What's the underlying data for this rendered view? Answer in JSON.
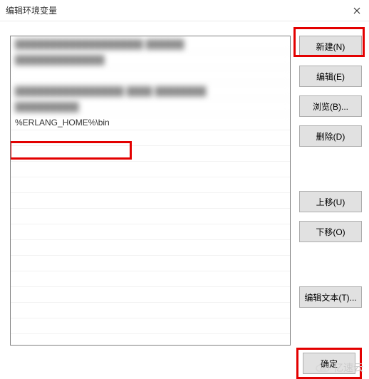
{
  "window": {
    "title": "编辑环境变量"
  },
  "list": {
    "rows": [
      "████████████████████  ██████",
      "██████████████",
      "",
      "█████████████████  ████  ████████",
      "██████████",
      "%ERLANG_HOME%\\bin"
    ],
    "highlighted_index": 5
  },
  "buttons": {
    "new": "新建(N)",
    "edit": "编辑(E)",
    "browse": "浏览(B)...",
    "delete": "删除(D)",
    "moveup": "上移(U)",
    "movedown": "下移(O)",
    "edittext": "编辑文本(T)...",
    "ok": "确定"
  },
  "watermark": "亿速云"
}
